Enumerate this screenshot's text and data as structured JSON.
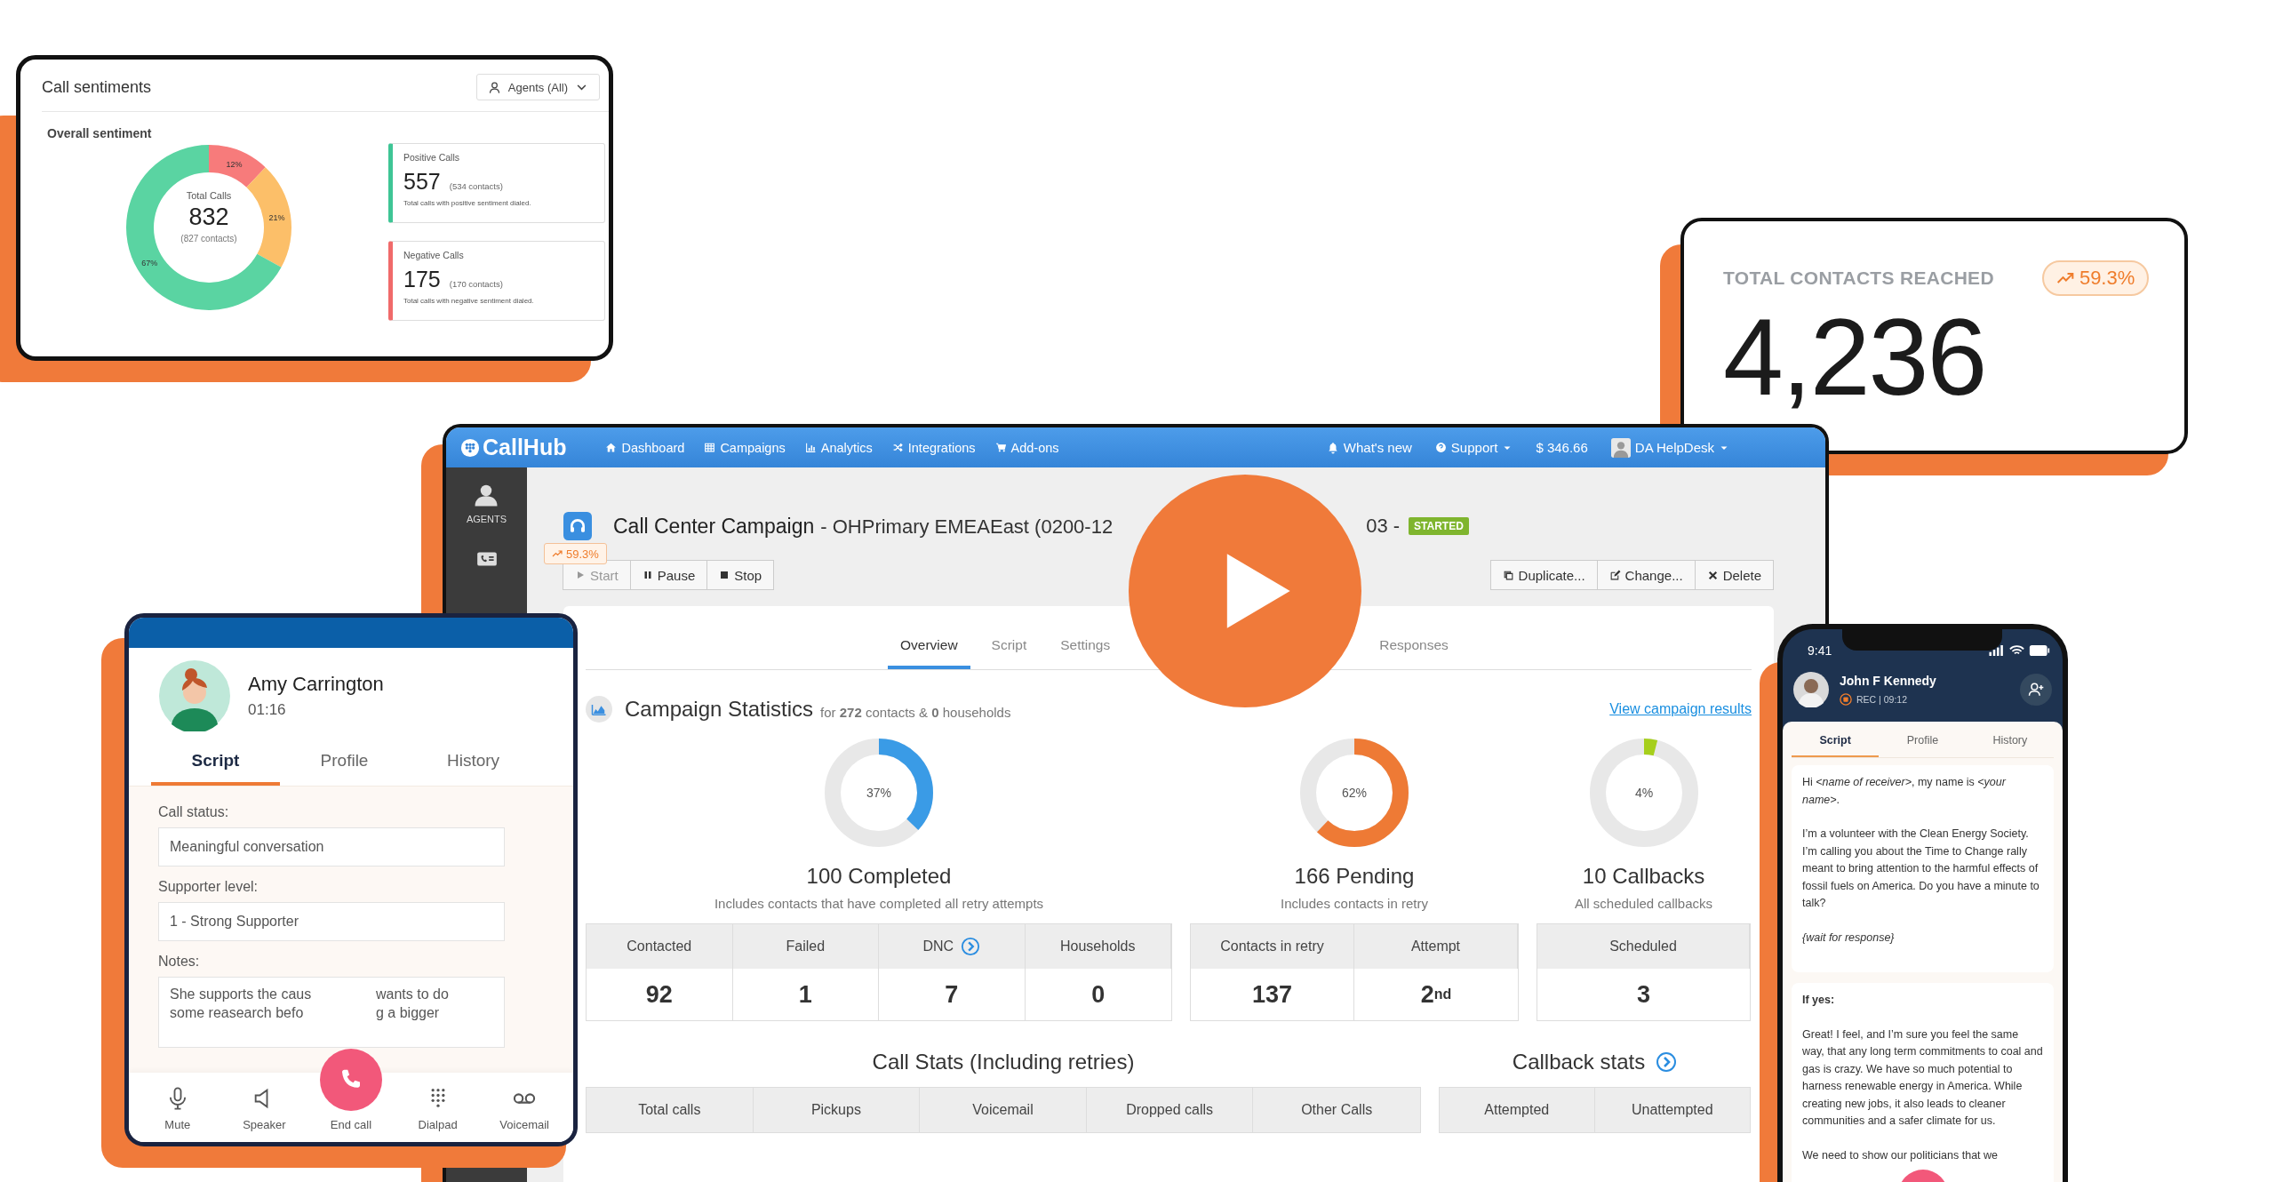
{
  "sentiment_card": {
    "title": "Call sentiments",
    "filter": "Agents (All)",
    "section_title": "Overall sentiment",
    "chart_data": {
      "type": "donut",
      "values": [
        12,
        21,
        67
      ],
      "colors": [
        "#f77b7b",
        "#fcbf69",
        "#5ad4a2"
      ],
      "value_labels": [
        "12%",
        "21%",
        "67%"
      ]
    },
    "center": {
      "label": "Total Calls",
      "value": "832",
      "note": "(827 contacts)"
    },
    "stats": [
      {
        "label": "Positive Calls",
        "value": "557",
        "note": "(534 contacts)",
        "description": "Total calls with positive sentiment dialed.",
        "color": "#3ec595"
      },
      {
        "label": "Negative Calls",
        "value": "175",
        "note": "(170 contacts)",
        "description": "Total calls with negative sentiment dialed.",
        "color": "#f06a6a"
      }
    ]
  },
  "contacts_card": {
    "label": "TOTAL CONTACTS REACHED",
    "value": "4,236",
    "badge": "59.3%"
  },
  "campaign_window": {
    "nav": {
      "logo": "CallHub",
      "items": [
        "Dashboard",
        "Campaigns",
        "Analytics",
        "Integrations",
        "Add-ons"
      ],
      "whats_new": "What's new",
      "support": "Support",
      "balance": "$ 346.66",
      "user": "DA HelpDesk"
    },
    "sidebar": {
      "label": "AGENTS"
    },
    "header": {
      "title": "Call Center Campaign",
      "subtitle": "- OHPrimary EMEAEast (0200-12",
      "subtitle_tail": "03 -",
      "status": "STARTED",
      "trend": "59.3%"
    },
    "controls": [
      {
        "label": "Start",
        "disabled": true
      },
      {
        "label": "Pause",
        "disabled": false
      },
      {
        "label": "Stop",
        "disabled": false
      }
    ],
    "actions": [
      "Duplicate...",
      "Change...",
      "Delete"
    ],
    "tabs": [
      {
        "label": "Overview",
        "selected": true
      },
      {
        "label": "Script",
        "selected": false
      },
      {
        "label": "Settings",
        "selected": false
      },
      {
        "label": "Responses",
        "selected": false
      }
    ],
    "statistics": {
      "title": "Campaign Statistics",
      "summary": "for **272** contacts & **0** households",
      "link": "View campaign results",
      "groups": [
        {
          "percent": "37%",
          "level": 0.37,
          "color": "#3a9be6",
          "headline": "100 Completed",
          "caption": "Includes contacts that have completed all retry attempts",
          "columns": [
            {
              "kind": "plain",
              "label": "Contacted",
              "value": "92"
            },
            {
              "kind": "plain",
              "label": "Failed",
              "value": "1"
            },
            {
              "kind": "link",
              "label": "DNC",
              "value": "7"
            },
            {
              "kind": "plain",
              "label": "Households",
              "value": "0"
            }
          ]
        },
        {
          "percent": "62%",
          "level": 0.62,
          "color": "#ee7a35",
          "headline": "166 Pending",
          "caption": "Includes contacts in retry",
          "columns": [
            {
              "kind": "plain",
              "label": "Contacts in retry",
              "value": "137"
            },
            {
              "kind": "plain",
              "label": "Attempt",
              "value": "2$^{nd}$"
            }
          ]
        },
        {
          "percent": "4%",
          "level": 0.04,
          "color": "#a6cf1c",
          "headline": "10 Callbacks",
          "caption": "All scheduled callbacks",
          "columns": [
            {
              "kind": "plain",
              "label": "Scheduled",
              "value": "3"
            }
          ]
        }
      ]
    },
    "call_stats": {
      "title": "Call Stats (Including retries)",
      "columns": [
        "Total calls",
        "Pickups",
        "Voicemail",
        "Dropped calls",
        "Other Calls"
      ]
    },
    "callback_stats": {
      "title": "Callback stats",
      "columns": [
        "Attempted",
        "Unattempted"
      ]
    }
  },
  "call_panel": {
    "name": "Amy Carrington",
    "duration": "01:16",
    "tabs": [
      {
        "label": "Script",
        "selected": true
      },
      {
        "label": "Profile",
        "selected": false
      },
      {
        "label": "History",
        "selected": false
      }
    ],
    "fields": [
      {
        "label": "Call status:",
        "value": "Meaningful conversation"
      },
      {
        "label": "Supporter level:",
        "value": "1 - Strong Supporter"
      }
    ],
    "notes": {
      "label": "Notes:",
      "lines": [
        [
          "She supports the caus",
          "wants to do"
        ],
        [
          "some reasearch befo",
          "g a bigger"
        ]
      ]
    },
    "controls": [
      {
        "kind": "mute",
        "label": "Mute"
      },
      {
        "kind": "speaker",
        "label": "Speaker"
      },
      {
        "kind": "end",
        "label": "End call"
      },
      {
        "kind": "dialpad",
        "label": "Dialpad"
      },
      {
        "kind": "voicemail",
        "label": "Voicemail"
      }
    ]
  },
  "phone": {
    "time": "9:41",
    "name": "John F Kennedy",
    "recording": "REC | 09:12",
    "tabs": [
      {
        "label": "Script",
        "selected": true
      },
      {
        "label": "Profile",
        "selected": false
      },
      {
        "label": "History",
        "selected": false
      }
    ],
    "script_cards": [
      {
        "paragraphs": [
          {
            "kind": "text",
            "text": "Hi *<name of receiver>*, my name is *<your name>*."
          },
          {
            "kind": "text",
            "text": "I’m a volunteer with the Clean Energy Society. I’m calling you about the Time to Change rally meant to bring attention to the harmful effects of fossil fuels on America. Do you have a minute to talk?"
          },
          {
            "kind": "note",
            "text": "{wait for response}"
          }
        ]
      },
      {
        "paragraphs": [
          {
            "kind": "heading",
            "text": "If yes:"
          },
          {
            "kind": "text",
            "text": "Great! I feel, and I’m sure you feel the same way, that any long term commitments to coal and gas is crazy. We have so much potential to harness renewable energy in America. While creating new jobs, it also leads to cleaner communities and a safer climate for us."
          },
          {
            "kind": "text",
            "text": "We need to show our politicians that we"
          }
        ]
      }
    ]
  }
}
